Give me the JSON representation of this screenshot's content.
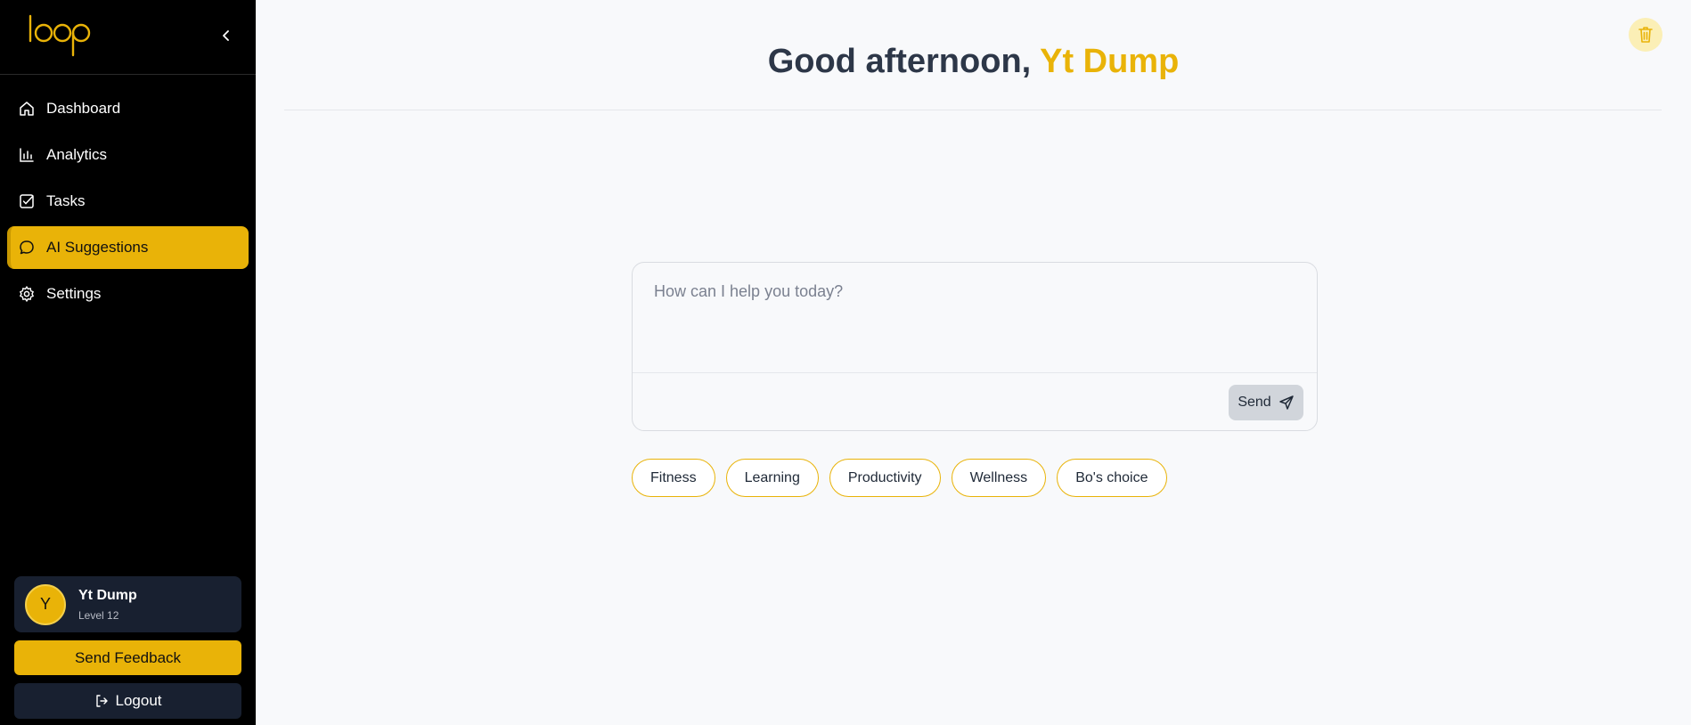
{
  "sidebar": {
    "logo_text": "loop",
    "collapse_icon": "chevron-left-icon",
    "items": [
      {
        "label": "Dashboard",
        "icon": "home-icon",
        "active": false
      },
      {
        "label": "Analytics",
        "icon": "bar-chart-icon",
        "active": false
      },
      {
        "label": "Tasks",
        "icon": "checkbox-icon",
        "active": false
      },
      {
        "label": "AI Suggestions",
        "icon": "chat-bubble-icon",
        "active": true
      },
      {
        "label": "Settings",
        "icon": "gear-icon",
        "active": false
      }
    ],
    "profile": {
      "initial": "Y",
      "name": "Yt Dump",
      "level": "Level 12"
    },
    "feedback_label": "Send Feedback",
    "logout_label": "Logout"
  },
  "main": {
    "greeting_prefix": "Good afternoon,",
    "greeting_name": "Yt Dump",
    "chat": {
      "placeholder": "How can I help you today?",
      "value": "",
      "send_label": "Send"
    },
    "chips": [
      "Fitness",
      "Learning",
      "Productivity",
      "Wellness",
      "Bo's choice"
    ]
  },
  "colors": {
    "accent": "#e9b308",
    "sidebar_bg": "#000000",
    "card_bg": "#182030",
    "page_bg": "#f8f9fb"
  }
}
